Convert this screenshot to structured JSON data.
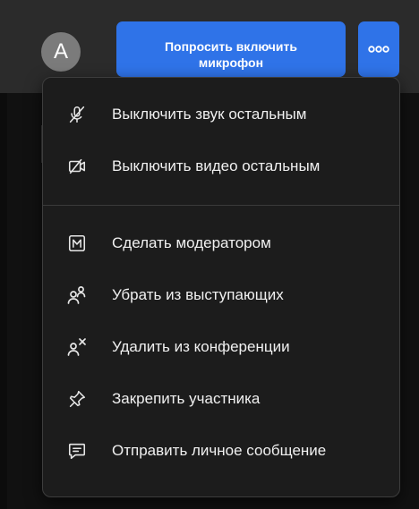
{
  "toolbar": {
    "avatar_initial": "A",
    "mic_request_line1": "Попросить включить",
    "mic_request_line2": "микрофон",
    "more_icon": "more-dots-icon",
    "accent_color": "#2f73e8"
  },
  "menu": {
    "items": [
      {
        "label": "Выключить звук остальным",
        "icon": "mic-off-icon"
      },
      {
        "label": "Выключить видео остальным",
        "icon": "video-off-icon"
      },
      {
        "label": "Сделать модератором",
        "icon": "moderator-icon"
      },
      {
        "label": "Убрать из выступающих",
        "icon": "remove-speaker-icon"
      },
      {
        "label": "Удалить из конференции",
        "icon": "remove-user-icon"
      },
      {
        "label": "Закрепить участника",
        "icon": "pin-icon"
      },
      {
        "label": "Отправить личное сообщение",
        "icon": "message-icon"
      }
    ]
  }
}
